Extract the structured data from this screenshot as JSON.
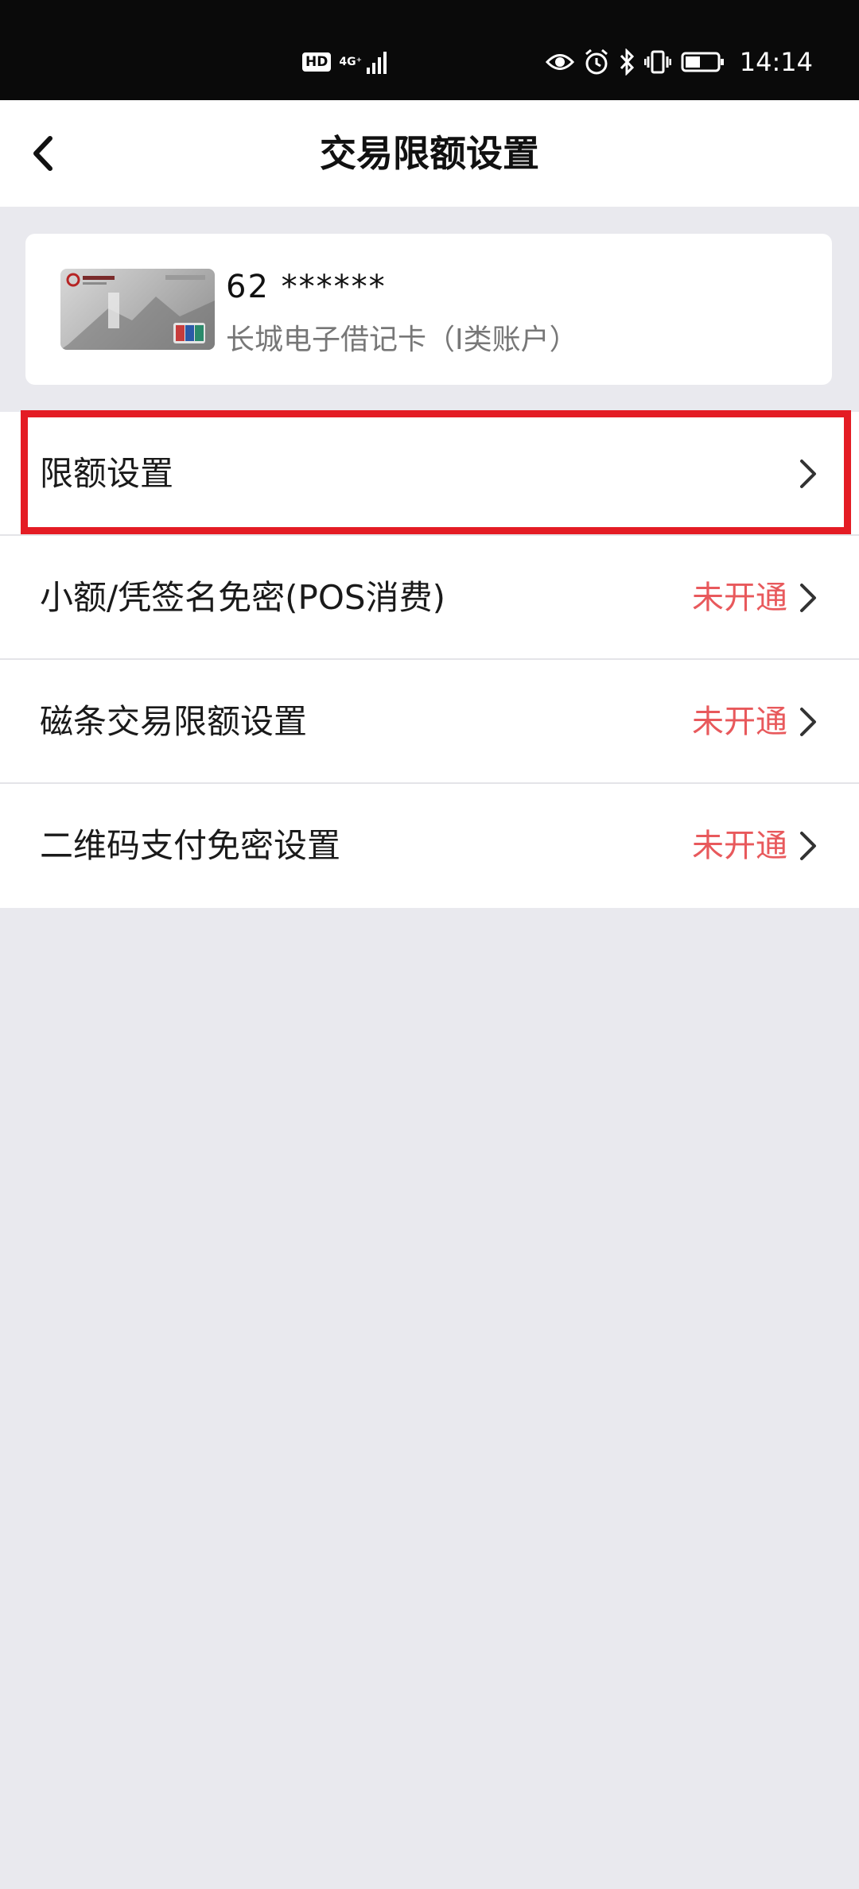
{
  "status_bar": {
    "hd": "HD",
    "network": "4G⁺",
    "time": "14:14",
    "icons": [
      "signal-icon",
      "eye-icon",
      "alarm-icon",
      "bluetooth-icon",
      "vibrate-icon",
      "battery-icon"
    ]
  },
  "header": {
    "back_icon": "chevron-left-icon",
    "title": "交易限额设置"
  },
  "account": {
    "card_number": "62     ******",
    "card_name": "长城电子借记卡（I类账户）",
    "card_image": "debit-card-image"
  },
  "menu": {
    "items": [
      {
        "label": "限额设置",
        "status": "",
        "highlighted": true
      },
      {
        "label": "小额/凭签名免密(POS消费)",
        "status": "未开通"
      },
      {
        "label": "磁条交易限额设置",
        "status": "未开通"
      },
      {
        "label": "二维码支付免密设置",
        "status": "未开通"
      }
    ]
  },
  "colors": {
    "status_bar_bg": "#0a0a0a",
    "page_bg": "#e9e9ee",
    "status_text": "#e8595c",
    "highlight_border": "#e41c24"
  }
}
